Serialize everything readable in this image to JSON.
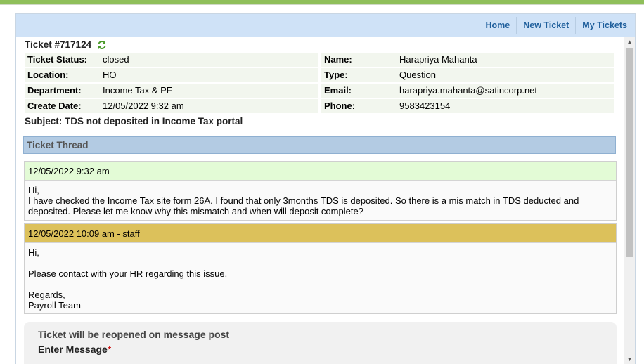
{
  "nav": {
    "home": "Home",
    "new_ticket": "New Ticket",
    "my_tickets": "My Tickets"
  },
  "ticket": {
    "title": "Ticket #717124",
    "status_label": "Ticket Status:",
    "status": "closed",
    "location_label": "Location:",
    "location": "HO",
    "department_label": "Department:",
    "department": "Income Tax & PF",
    "create_date_label": "Create Date:",
    "create_date": "12/05/2022 9:32 am",
    "name_label": "Name:",
    "name": "Harapriya Mahanta",
    "type_label": "Type:",
    "type": "Question",
    "email_label": "Email:",
    "email": "harapriya.mahanta@satincorp.net",
    "phone_label": "Phone:",
    "phone": "9583423154",
    "subject": "Subject: TDS not deposited in Income Tax portal"
  },
  "thread": {
    "title": "Ticket Thread",
    "messages": [
      {
        "header": "12/05/2022 9:32 am",
        "body": "Hi,\nI have checked the Income Tax site form 26A. I found that only 3months TDS is deposited. So there is a mis match in TDS deducted and deposited. Please let me know why this mismatch and when will deposit complete?"
      },
      {
        "header": "12/05/2022 10:09 am - staff",
        "body": "Hi,\n\nPlease contact with your HR regarding this issue.\n\nRegards,\nPayroll Team"
      }
    ]
  },
  "reply": {
    "reopen_note": "Ticket will be reopened on message post",
    "enter_message_label": "Enter Message",
    "required_mark": "*"
  },
  "colors": {
    "nav_bg": "#cfe2f7",
    "thread_header": "#b3cbe3",
    "client_msg": "#e3fbd6",
    "staff_msg": "#dcc15b"
  }
}
